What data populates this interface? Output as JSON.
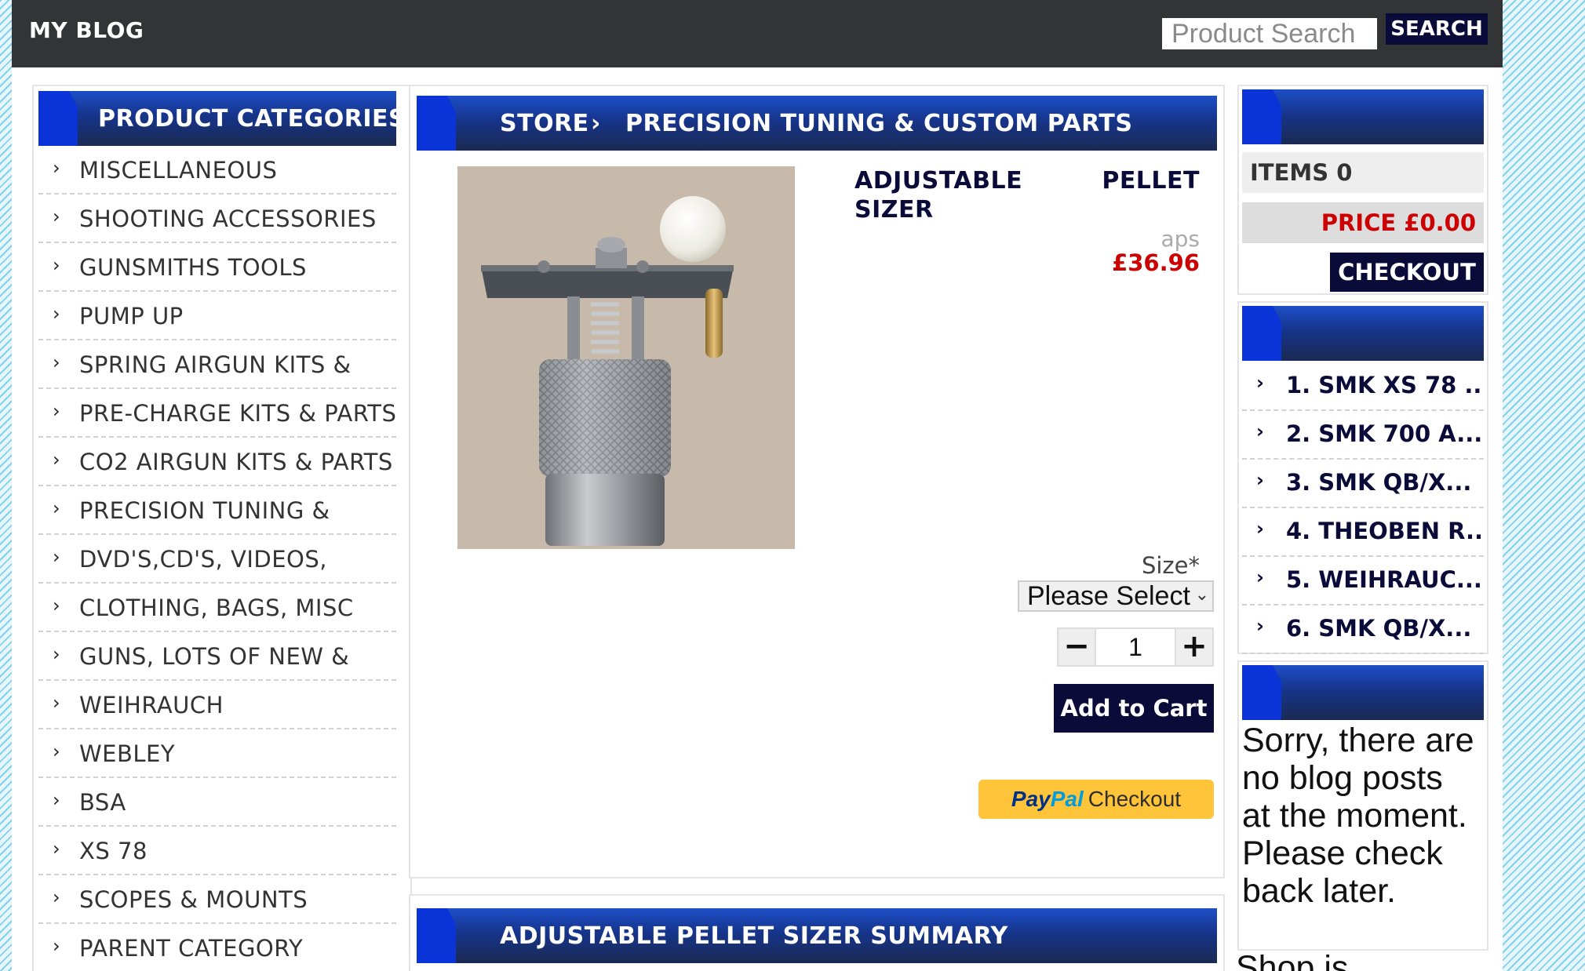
{
  "header": {
    "site_title": "MY BLOG",
    "search": {
      "placeholder": "Product Search",
      "value": "",
      "button_label": "SEARCH"
    }
  },
  "sidebar": {
    "title": "PRODUCT CATEGORIES",
    "categories": [
      "MISCELLANEOUS",
      "SHOOTING ACCESSORIES",
      "GUNSMITHS TOOLS",
      "PUMP UP",
      "SPRING AIRGUN KITS &",
      "PRE-CHARGE KITS & PARTS",
      "CO2 AIRGUN KITS & PARTS",
      "PRECISION TUNING &",
      "DVD'S,CD'S, VIDEOS,",
      "CLOTHING, BAGS, MISC",
      "GUNS, LOTS OF NEW &",
      "WEIHRAUCH",
      "WEBLEY",
      "BSA",
      "XS 78",
      "SCOPES & MOUNTS",
      "PARENT CATEGORY"
    ]
  },
  "breadcrumb": {
    "store": "STORE",
    "separator": "›",
    "current": "PRECISION TUNING & CUSTOM PARTS"
  },
  "product": {
    "title_word1": "ADJUSTABLE",
    "title_word2": "PELLET",
    "title_word3": "SIZER",
    "sku": "aps",
    "price": "£36.96",
    "size_label": "Size*",
    "size_selected": "Please Select",
    "quantity": "1",
    "add_to_cart_label": "Add to Cart",
    "paypal": {
      "brand_part1": "Pay",
      "brand_part2": "Pal",
      "label": "Checkout"
    }
  },
  "summary": {
    "title": "ADJUSTABLE PELLET SIZER SUMMARY"
  },
  "cart": {
    "items_label": "ITEMS 0",
    "price_label": "PRICE £0.00",
    "checkout_label": "CHECKOUT"
  },
  "bestsellers": {
    "items": [
      "1. SMK XS 78 ...",
      "2. SMK 700 A...",
      "3. SMK QB/X...",
      "4. THEOBEN R...",
      "5. WEIHRAUC...",
      "6. SMK QB/X..."
    ]
  },
  "blog": {
    "message": "Sorry, there are no blog posts at the moment. Please check back later.",
    "shop_note": "Shop is"
  },
  "icons": {
    "chevron": "chevron-right-icon",
    "minus": "minus-icon",
    "plus": "plus-icon",
    "dropdown": "chevron-down-icon"
  },
  "colors": {
    "topbar": "#333436",
    "navy": "#0b0b3a",
    "ribbon_blue": "#1d4fc8",
    "price_red": "#cc0000",
    "paypal_yellow": "#ffc439"
  }
}
